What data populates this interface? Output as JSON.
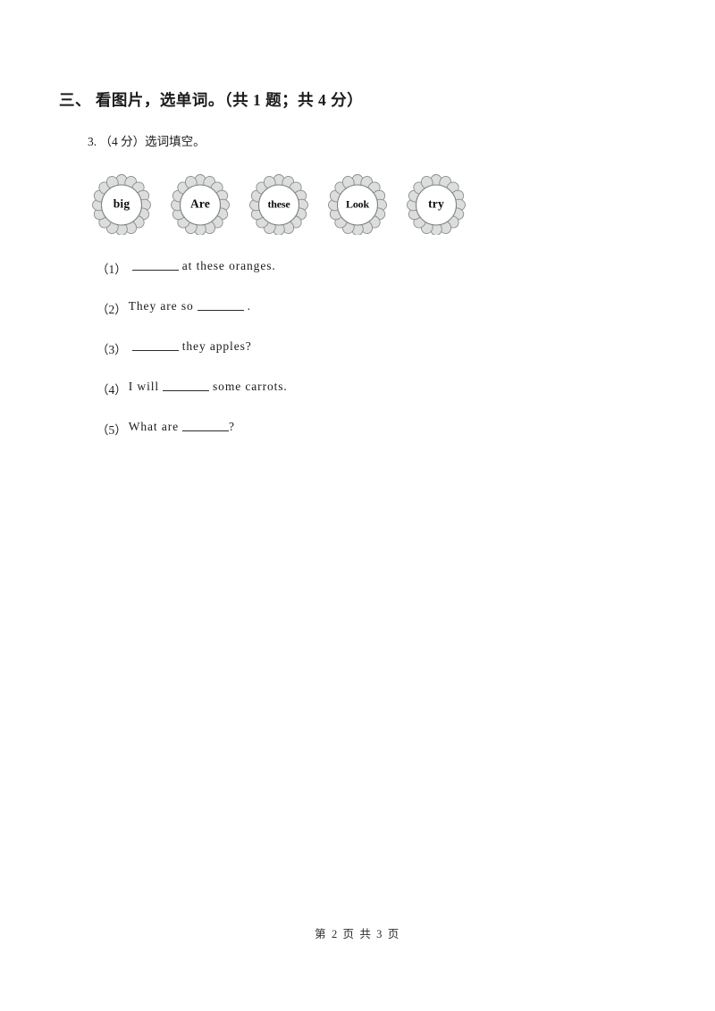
{
  "document": {
    "section": {
      "number": "三、",
      "title": "看图片，选单词。",
      "score_note": "（共 1 题；共 4 分）",
      "full_text": "三、 看图片，选单词。（共 1 题；共 4 分）"
    },
    "question": {
      "number": "3.",
      "score": "（4 分）",
      "prompt": "选词填空。",
      "full_text": "3. （4 分）选词填空。"
    },
    "word_bank": {
      "badge_fill": "#dcdedd",
      "badge_stroke": "#8a8d8d",
      "items": [
        {
          "word": "big",
          "size": "normal"
        },
        {
          "word": "Are",
          "size": "normal"
        },
        {
          "word": "these",
          "size": "small"
        },
        {
          "word": "Look",
          "size": "small"
        },
        {
          "word": "try",
          "size": "normal"
        }
      ]
    },
    "answers": [
      {
        "label": "（1）",
        "before": "",
        "after": "at these oranges."
      },
      {
        "label": "（2）",
        "before": "They are so",
        "after": "."
      },
      {
        "label": "（3）",
        "before": "",
        "after": "they apples?"
      },
      {
        "label": "（4）",
        "before": "I will",
        "after": "some carrots."
      },
      {
        "label": "（5）",
        "before": "What are",
        "after": "?"
      }
    ],
    "footer": {
      "text": "第 2 页 共 3 页",
      "current_page": "2",
      "total_pages": "3"
    }
  }
}
